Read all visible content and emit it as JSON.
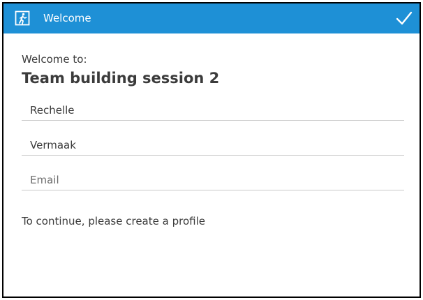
{
  "titlebar": {
    "title": "Welcome",
    "exit_icon": "exit-door-icon",
    "confirm_icon": "checkmark-icon",
    "color": "#1e90d6"
  },
  "content": {
    "welcome_label": "Welcome to:",
    "session_name": "Team building session 2",
    "fields": {
      "first_name": {
        "value": "Rechelle",
        "placeholder": ""
      },
      "last_name": {
        "value": "Vermaak",
        "placeholder": ""
      },
      "email": {
        "value": "",
        "placeholder": "Email"
      }
    },
    "instruction": "To continue, please create a profile"
  }
}
